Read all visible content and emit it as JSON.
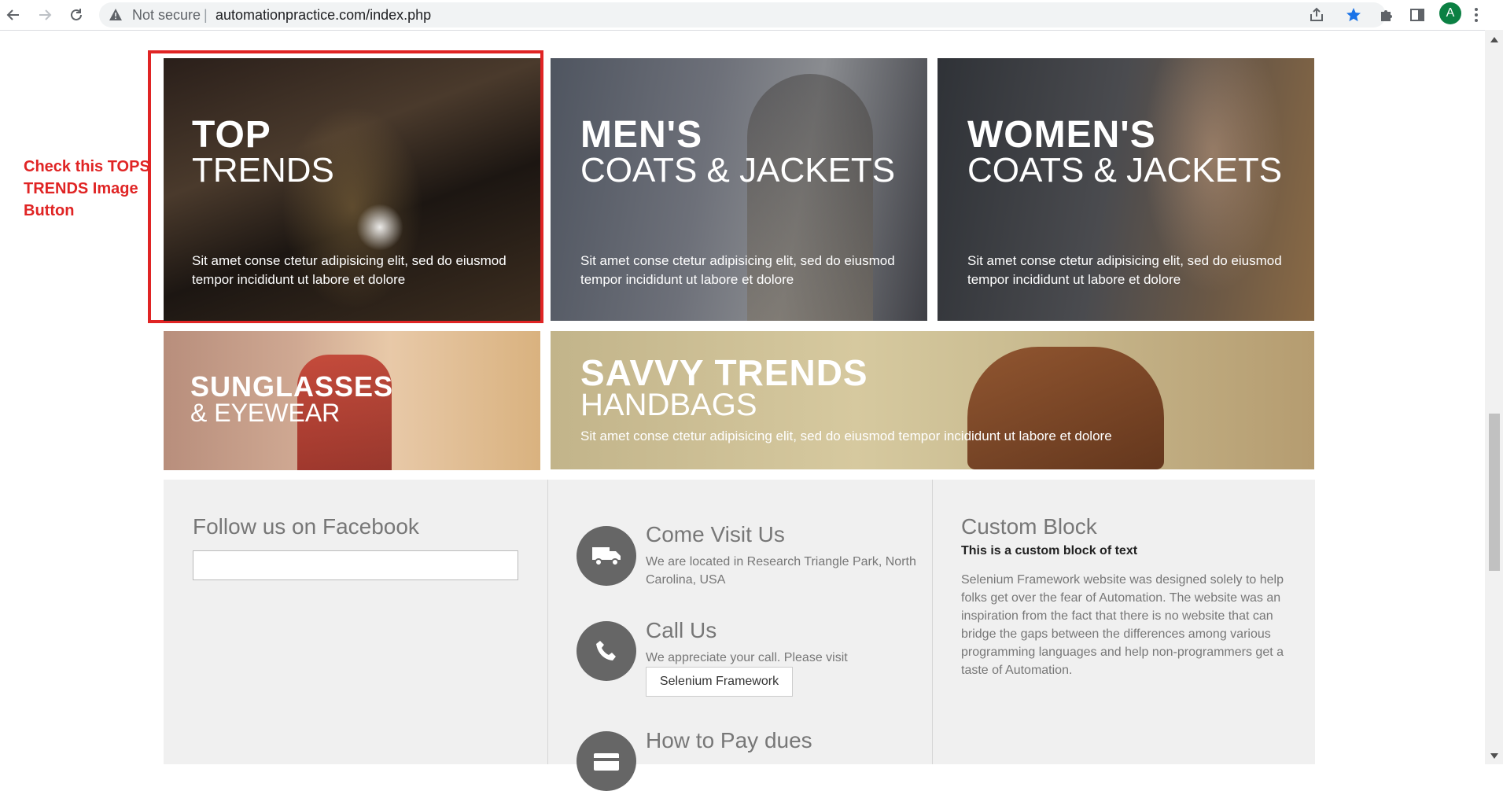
{
  "browser": {
    "security_label": "Not secure",
    "separator": "|",
    "url": "automationpractice.com/index.php",
    "avatar_letter": "A"
  },
  "annotation": {
    "line1": "Check this TOPS",
    "line2": "TRENDS Image",
    "line3": "Button",
    "color": "#e02424"
  },
  "banners": {
    "top_trends": {
      "title": "TOP",
      "subtitle": "TRENDS",
      "text": "Sit amet conse ctetur adipisicing elit, sed do eiusmod tempor incididunt ut labore et dolore"
    },
    "mens": {
      "title": "MEN'S",
      "subtitle": "COATS & JACKETS",
      "text": "Sit amet conse ctetur adipisicing elit, sed do eiusmod tempor incididunt ut labore et dolore"
    },
    "womens": {
      "title": "WOMEN'S",
      "subtitle": "COATS & JACKETS",
      "text": "Sit amet conse ctetur adipisicing elit, sed do eiusmod tempor incididunt ut labore et dolore"
    },
    "sunglasses": {
      "title": "SUNGLASSES",
      "subtitle": "& EYEWEAR"
    },
    "savvy": {
      "title": "SAVVY TRENDS",
      "subtitle": "HANDBAGS",
      "text": "Sit amet conse ctetur adipisicing elit, sed do eiusmod tempor incididunt ut labore et dolore"
    }
  },
  "footer": {
    "facebook": {
      "heading": "Follow us on Facebook"
    },
    "visit": {
      "heading": "Come Visit Us",
      "text": "We are located in Research Triangle Park, North Carolina, USA"
    },
    "call": {
      "heading": "Call Us",
      "text": "We appreciate your call. Please visit",
      "button": "Selenium Framework"
    },
    "pay": {
      "heading": "How to Pay dues"
    },
    "custom": {
      "heading": "Custom Block",
      "subheading": "This is a custom block of text",
      "text": "Selenium Framework website was designed solely to help folks get over the fear of Automation. The website was an inspiration from the fact that there is no website that can bridge the gaps between the differences among various programming languages and help non-programmers get a taste of Automation."
    }
  }
}
